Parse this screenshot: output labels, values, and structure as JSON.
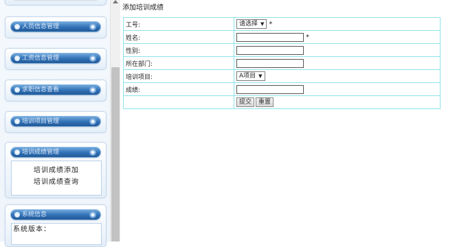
{
  "sidebar": {
    "menus": [
      {
        "label": "人员信息管理"
      },
      {
        "label": "工资信息管理"
      },
      {
        "label": "求职信息查看"
      },
      {
        "label": "培训项目管理"
      },
      {
        "label": "培训成绩管理",
        "sub_items": [
          "培训成绩添加",
          "培训成绩查询"
        ]
      },
      {
        "label": "系统信息",
        "sub_items": [
          "系统版本："
        ]
      }
    ]
  },
  "page": {
    "title": "添加培训成绩"
  },
  "form": {
    "employee_id": {
      "label": "工号:",
      "select_value": "请选择",
      "required_mark": "*"
    },
    "name": {
      "label": "姓名:",
      "value": "",
      "required_mark": "*"
    },
    "gender": {
      "label": "性别:",
      "value": ""
    },
    "department": {
      "label": "所在部门:",
      "value": ""
    },
    "project": {
      "label": "培训项目:",
      "select_value": "A项目"
    },
    "score": {
      "label": "成绩:",
      "value": ""
    },
    "submit_label": "提交",
    "reset_label": "重置"
  },
  "icons": {
    "scroll_up": "scroll-up-arrow-icon",
    "menu_bullet": "bullet-icon",
    "menu_toggle": "toggle-icon",
    "dropdown": "chevron-down-icon"
  },
  "colors": {
    "table_border": "#8ee2ea",
    "menu_button": "#2f6fb4"
  }
}
